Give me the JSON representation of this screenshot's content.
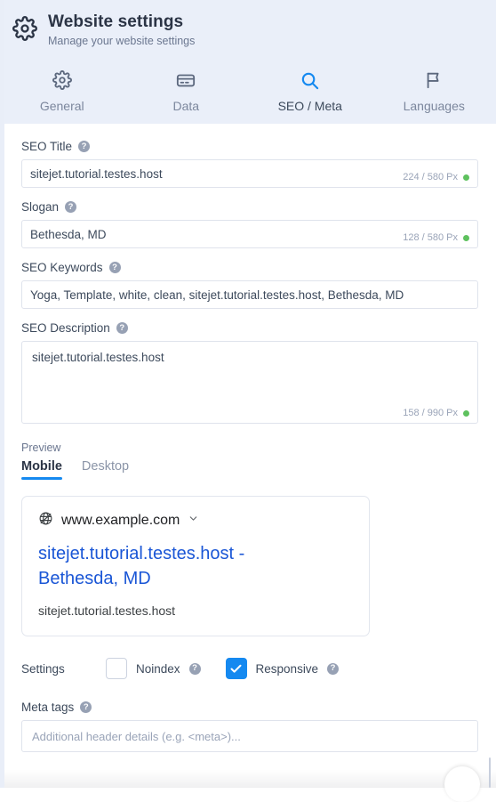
{
  "header": {
    "icon": "gear-icon",
    "title": "Website settings",
    "subtitle": "Manage your website settings"
  },
  "tabs": [
    {
      "label": "General",
      "icon": "gear-icon",
      "active": false
    },
    {
      "label": "Data",
      "icon": "credit-card-icon",
      "active": false
    },
    {
      "label": "SEO / Meta",
      "icon": "search-icon",
      "active": true
    },
    {
      "label": "Languages",
      "icon": "flag-icon",
      "active": false
    }
  ],
  "fields": {
    "seo_title": {
      "label": "SEO Title",
      "value": "sitejet.tutorial.testes.host",
      "counter": "224 / 580 Px",
      "status": "ok"
    },
    "slogan": {
      "label": "Slogan",
      "value": "Bethesda, MD",
      "counter": "128 / 580 Px",
      "status": "ok"
    },
    "seo_keywords": {
      "label": "SEO Keywords",
      "value": "Yoga, Template, white, clean, sitejet.tutorial.testes.host, Bethesda, MD"
    },
    "seo_description": {
      "label": "SEO Description",
      "value": "sitejet.tutorial.testes.host",
      "counter": "158 / 990 Px",
      "status": "ok"
    }
  },
  "preview": {
    "label": "Preview",
    "tabs": [
      {
        "label": "Mobile",
        "active": true
      },
      {
        "label": "Desktop",
        "active": false
      }
    ],
    "card": {
      "favicon": "globe-icon",
      "url": "www.example.com",
      "chevron": "chevron-down-icon",
      "title": "sitejet.tutorial.testes.host - Bethesda, MD",
      "description": "sitejet.tutorial.testes.host"
    }
  },
  "settings": {
    "label": "Settings",
    "checkboxes": [
      {
        "label": "Noindex",
        "checked": false
      },
      {
        "label": "Responsive",
        "checked": true
      }
    ]
  },
  "meta_tags": {
    "label": "Meta tags",
    "placeholder": "Additional header details (e.g. <meta>)..."
  },
  "colors": {
    "accent": "#1589f0",
    "header_bg": "#eaeff9",
    "status_ok": "#5ec15e",
    "link": "#1a56d6"
  }
}
